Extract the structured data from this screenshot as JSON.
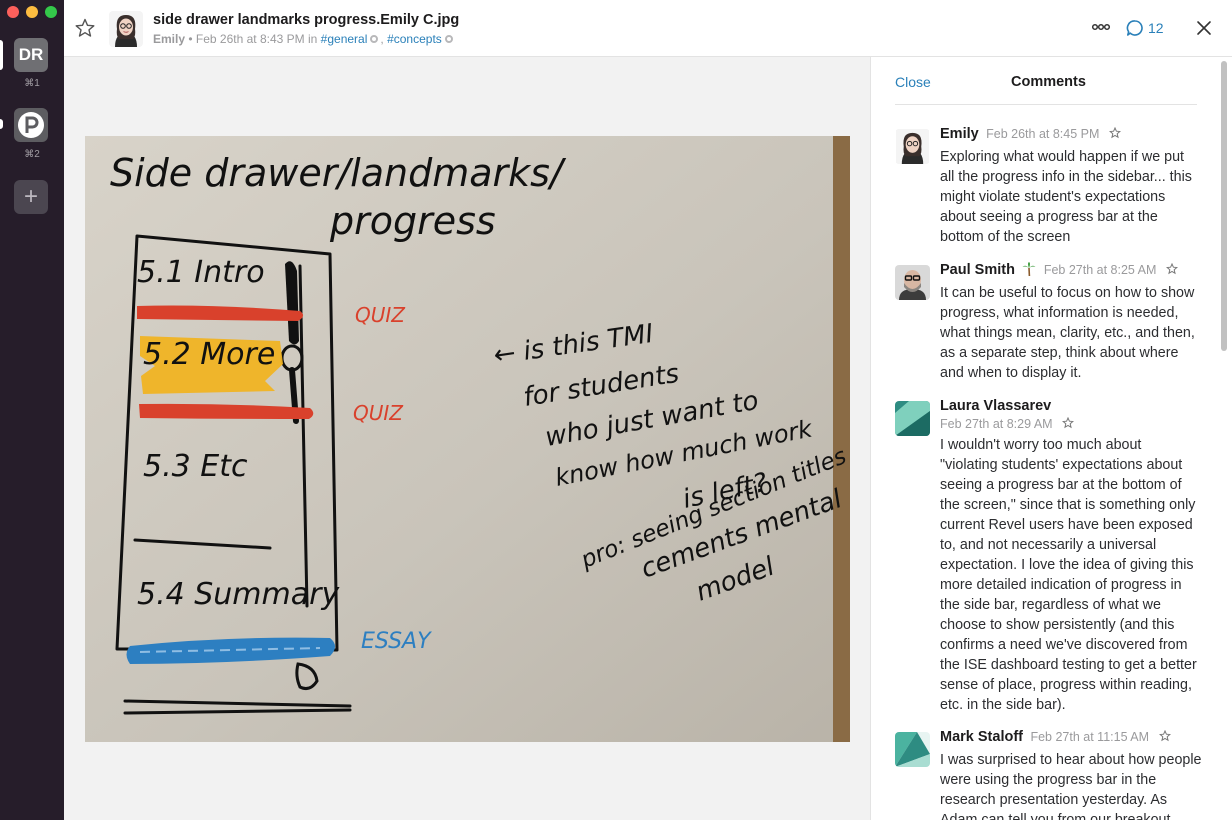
{
  "workspaces": [
    {
      "initials": "DR",
      "shortcut": "⌘1"
    },
    {
      "initials": "P",
      "shortcut": "⌘2"
    },
    {
      "add_label": "+"
    }
  ],
  "file": {
    "title": "side drawer landmarks progress.Emily C.jpg",
    "author": "Emily",
    "separator": "•",
    "timestamp": "Feb 26th at 8:43 PM",
    "in_label": "in",
    "channels": [
      "#general",
      "#concepts"
    ],
    "channel_sep": ","
  },
  "header_actions": {
    "comment_count": "12"
  },
  "comments_panel": {
    "close_label": "Close",
    "title": "Comments",
    "comments": [
      {
        "author": "Emily",
        "time": "Feb 26th at 8:45 PM",
        "text": "Exploring what would happen if we put all the progress info in the sidebar... this might violate student's expectations about seeing a progress bar at the bottom of the screen"
      },
      {
        "author": "Paul Smith",
        "status_emoji": "palm-tree-icon",
        "time": "Feb 27th at 8:25 AM",
        "text": "It can be useful to focus on how to show progress, what information is needed, what things mean, clarity, etc., and then, as a separate step, think about where and when to display it."
      },
      {
        "author": "Laura Vlassarev",
        "time": "Feb 27th at 8:29 AM",
        "text": "I wouldn't worry too much about \"violating students' expectations about seeing a progress bar at the bottom of the screen,\" since that is something only current Revel users have been exposed to, and not necessarily a universal expectation. I love the idea of giving this more detailed indication of progress in the side bar, regardless of what we choose to show persistently (and this confirms a need we've discovered from the ISE dashboard testing to get a better sense of place, progress within reading, etc. in the side bar)."
      },
      {
        "author": "Mark Staloff",
        "time": "Feb 27th at 11:15 AM",
        "text": "I was surprised to hear about how people were using the progress bar in the research presentation yesterday. As Adam can tell you from our breakout"
      }
    ]
  },
  "sketch": {
    "title_line1": "Side drawer/landmarks/",
    "title_line2": "progress",
    "sections": [
      "5.1 Intro",
      "5.2 More",
      "5.3 Etc",
      "5.4 Summary"
    ],
    "markers": [
      "QUIZ",
      "QUIZ",
      "ESSAY"
    ],
    "note_lines": [
      "← is this TMI",
      "for students",
      "who just want to",
      "know how much work",
      "is left?",
      "pro: seeing section titles",
      "cements mental",
      "model"
    ]
  },
  "colors": {
    "rail_bg": "#261d2a",
    "link_blue": "#2a80b9",
    "quiz_red": "#d9412c",
    "highlight_yellow": "#f0b323",
    "essay_blue": "#2d7fc1"
  }
}
